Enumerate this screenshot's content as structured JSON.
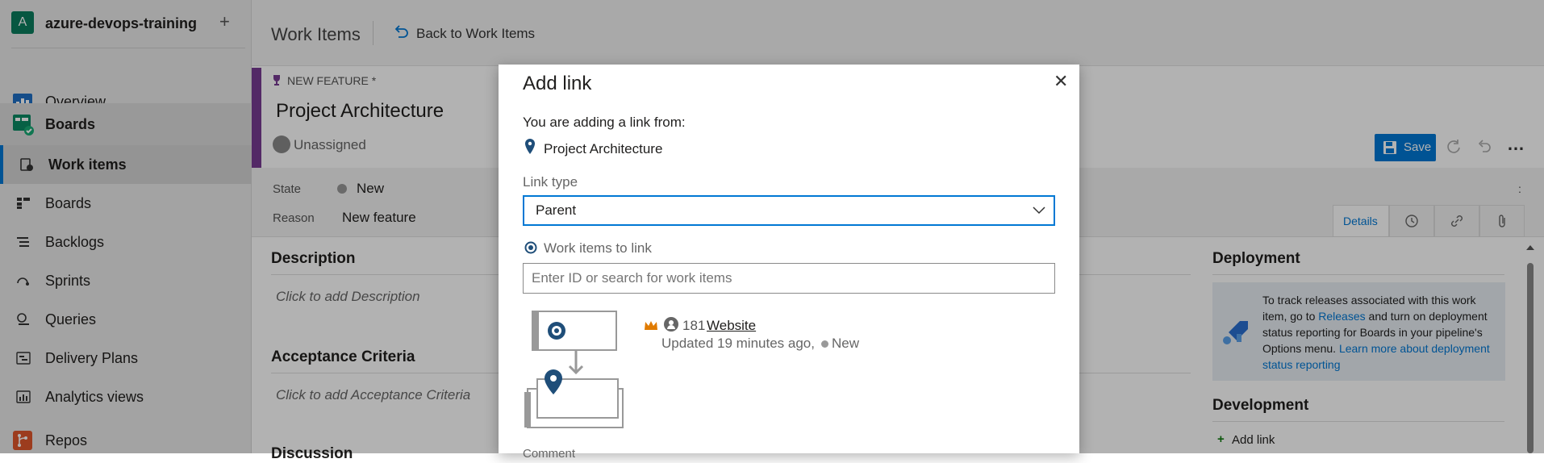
{
  "project": {
    "avatar_letter": "A",
    "name": "azure-devops-training",
    "add": "+"
  },
  "nav": {
    "overview": "Overview",
    "boards_hub": "Boards",
    "work_items": "Work items",
    "boards": "Boards",
    "backlogs": "Backlogs",
    "sprints": "Sprints",
    "queries": "Queries",
    "delivery_plans": "Delivery Plans",
    "analytics_views": "Analytics views",
    "repos": "Repos"
  },
  "topbar": {
    "title": "Work Items",
    "back_label": "Back to Work Items"
  },
  "work_item": {
    "type_label": "NEW FEATURE *",
    "title": "Project Architecture",
    "assignee": "Unassigned",
    "state_label": "State",
    "state_value": "New",
    "reason_label": "Reason",
    "reason_value": "New feature"
  },
  "toolbar": {
    "save_label": "Save",
    "more": "…"
  },
  "tabs": {
    "details": "Details"
  },
  "sections": {
    "description_title": "Description",
    "description_placeholder": "Click to add Description",
    "acceptance_title": "Acceptance Criteria",
    "acceptance_placeholder": "Click to add Acceptance Criteria",
    "discussion_title": "Discussion"
  },
  "deployment": {
    "title": "Deployment",
    "text_1": "To track releases associated with this work item, go to",
    "releases_link": "Releases",
    "text_2": "and turn on deployment status reporting for Boards in your pipeline's Options menu.",
    "learn_more_link": "Learn more about deployment status reporting"
  },
  "development": {
    "title": "Development",
    "add_link": "Add link"
  },
  "dialog": {
    "title": "Add link",
    "close": "✕",
    "from_label": "You are adding a link from:",
    "from_item": "Project Architecture",
    "link_type_label": "Link type",
    "link_type_value": "Parent",
    "work_items_label": "Work items to link",
    "search_placeholder": "Enter ID or search for work items",
    "result": {
      "id": "181",
      "title": "Website",
      "updated": "Updated 19 minutes ago,",
      "state": "New"
    },
    "cut_text": "Comment"
  },
  "colors": {
    "accent": "#0078d4",
    "feature_purple": "#773b93",
    "project_green": "#0b7d5e"
  }
}
